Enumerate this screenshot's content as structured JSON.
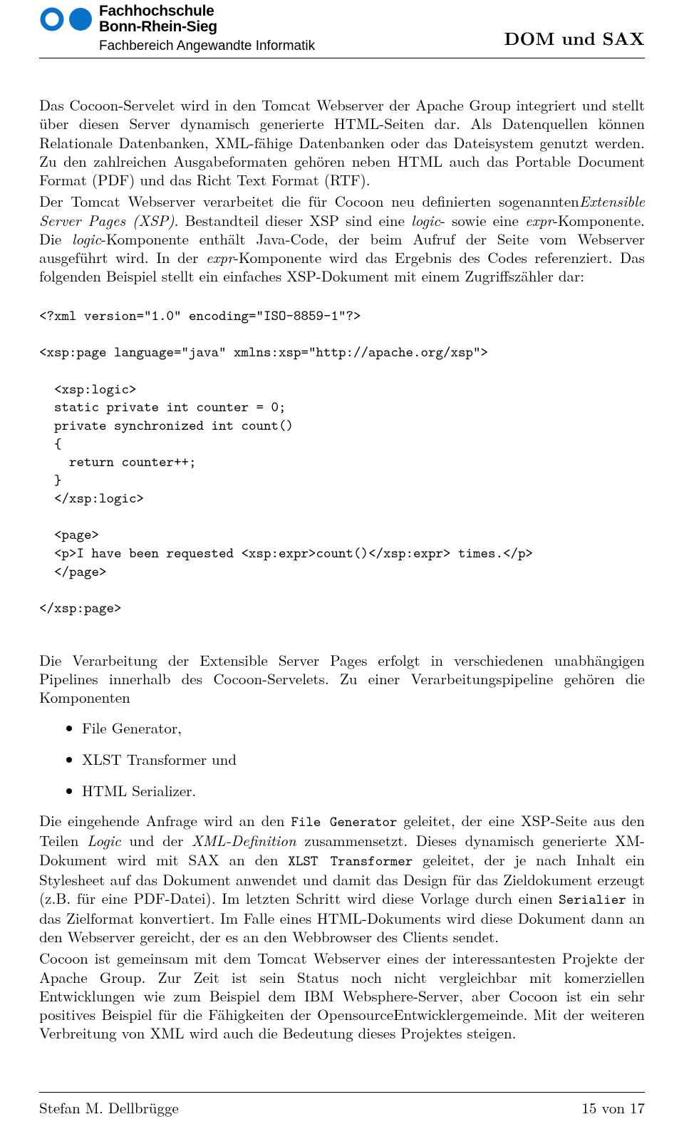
{
  "header": {
    "university_line1": "Fachhochschule",
    "university_line2": "Bonn-Rhein-Sieg",
    "department": "Fachbereich Angewandte Informatik",
    "running_title": "DOM und SAX"
  },
  "body": {
    "p1": "Das Cocoon-Servelet wird in den Tomcat Webserver der Apache Group integriert und stellt über diesen Server dynamisch generierte HTML-Seiten dar. Als Datenquellen können Relationale Datenbanken, XML-fähige Datenbanken oder das Dateisystem genutzt werden. Zu den zahlreichen Ausgabeformaten gehören neben HTML auch das Portable Document Format (PDF) und das Richt Text Format (RTF).",
    "p2_a": "Der Tomcat Webserver verarbeitet die für Cocoon neu definierten sogenannten",
    "p2_i_ext": "Extensible Server Pages (XSP)",
    "p2_b": ". Bestandteil dieser XSP sind eine ",
    "p2_i_logic": "logic",
    "p2_c": "- sowie eine ",
    "p2_i_expr": "expr",
    "p2_d": "-Komponente. Die ",
    "p2_i_logic2": "logic",
    "p2_e": "-Komponente enthält Java-Code, der beim Aufruf der Seite vom Webserver ausgeführt wird. In der ",
    "p2_i_expr2": "expr",
    "p2_f": "-Komponente wird das Ergebnis des Codes referenziert. Das folgenden Beispiel stellt ein einfaches XSP-Dokument mit einem Zugriffszähler dar:",
    "code_xmlDecl": "<?xml version=\"1.0\" encoding=\"ISO-8859-1\"?>",
    "code_xspOpen": "<xsp:page language=\"java\" xmlns:xsp=\"http://apache.org/xsp\">",
    "code_block": "  <xsp:logic>\n  static private int counter = 0;\n  private synchronized int count()\n  {\n    return counter++;\n  }\n  </xsp:logic>\n\n  <page>\n  <p>I have been requested <xsp:expr>count()</xsp:expr> times.</p>\n  </page>",
    "code_xspClose": "</xsp:page>",
    "p3": "Die Verarbeitung der Extensible Server Pages erfolgt in verschiedenen unabhängigen Pipelines innerhalb des Cocoon-Servelets. Zu einer Verarbeitungspipeline gehören die Komponenten",
    "bullets": [
      "File Generator,",
      "XLST Transformer und",
      "HTML Serializer."
    ],
    "p4_a": "Die eingehende Anfrage wird an den ",
    "p4_tt_fg": "File Generator",
    "p4_b": " geleitet, der eine XSP-Seite aus den Teilen ",
    "p4_i_logic": "Logic",
    "p4_c": " und der ",
    "p4_i_xml": "XML-Definition",
    "p4_d": " zusammensetzt. Dieses dynamisch generierte XM-Dokument wird mit SAX an den ",
    "p4_tt_xt": "XLST Transformer",
    "p4_e": " geleitet, der je nach Inhalt ein Stylesheet auf das Dokument anwendet und damit das Design für das Zieldokument erzeugt (z.B. für eine PDF-Datei). Im letzten Schritt wird diese Vorlage durch einen ",
    "p4_tt_ser": "Serialier",
    "p4_f": " in das Zielformat konvertiert. Im Falle eines HTML-Dokuments wird diese Dokument dann an den Webserver gereicht, der es an den Webbrowser des Clients sendet.",
    "p5": "Cocoon ist gemeinsam mit dem Tomcat Webserver eines der interessantesten Projekte der Apache Group. Zur Zeit ist sein Status noch nicht vergleichbar mit komerziellen Entwicklungen wie zum Beispiel dem IBM Websphere-Server, aber Cocoon ist ein sehr positives Beispiel für die Fähigkeiten der OpensourceEntwicklergemeinde. Mit der weiteren Verbreitung von XML wird auch die Bedeutung dieses Projektes steigen."
  },
  "footer": {
    "author": "Stefan M. Dellbrügge",
    "page": "15 von 17"
  }
}
